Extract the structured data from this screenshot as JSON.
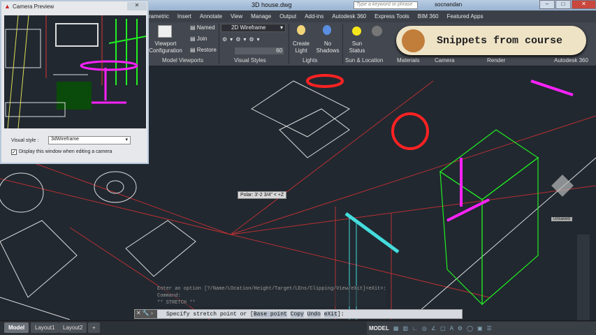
{
  "titlebar": {
    "document": "3D house.dwg",
    "search_placeholder": "Type a keyword or phrase",
    "user": "socnandan"
  },
  "tabs": [
    "rametric",
    "Insert",
    "Annotate",
    "View",
    "Manage",
    "Output",
    "Add-ins",
    "Autodesk 360",
    "Express Tools",
    "BIM 360",
    "Featured Apps"
  ],
  "ribbon": {
    "viewport_config": "Viewport Configuration",
    "named": "Named",
    "join": "Join",
    "restore": "Restore",
    "visual_style": "2D Wireframe",
    "opacity_value": "60",
    "create_light": "Create Light",
    "no_shadows": "No Shadows",
    "sun_status": "Sun Status",
    "panels": [
      "Model Viewports",
      "Visual Styles",
      "Lights",
      "Sun & Location",
      "Materials",
      "Camera",
      "Render",
      "Autodesk 360"
    ]
  },
  "banner": {
    "text": "Snippets from course",
    "accent": "#c17e3a"
  },
  "camera_preview": {
    "title": "Camera Preview",
    "visual_style_label": "Visual style :",
    "visual_style": "3dWireframe",
    "checkbox_label": "Display this window when editing a camera",
    "checked": true
  },
  "tooltip": "Polar: 3'-2 3/4\" < +Z",
  "history": [
    "Enter an option [?/Name/LOcation/Height/Target/LEns/Clipping/View/eXit]<eXit>:",
    "Command:",
    "** STRETCH **"
  ],
  "command": {
    "prompt": "Specify stretch point or [",
    "options": [
      "Base point",
      "Copy",
      "Undo",
      "eXit"
    ],
    "suffix": "]:"
  },
  "viewcube": {
    "label": "Unsaved"
  },
  "layout_tabs": [
    "Model",
    "Layout1",
    "Layout2",
    "+"
  ],
  "status": {
    "model": "MODEL"
  }
}
